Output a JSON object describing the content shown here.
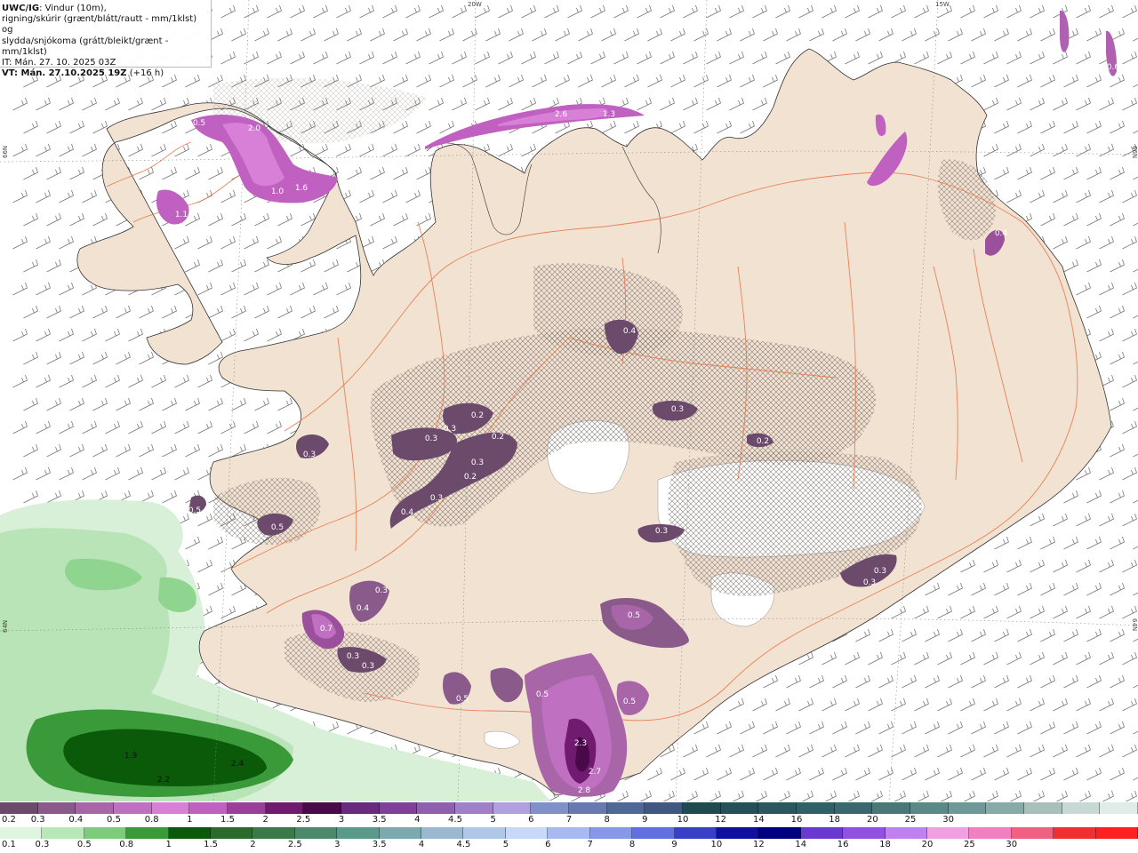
{
  "header": {
    "product": "UWC/IG",
    "line1_rest": ": Vindur (10m),",
    "line2": "rigning/skúrir (grænt/blátt/rautt - mm/1klst) og",
    "line3": "slydda/snjókoma (grátt/bleikt/grænt - mm/1klst)",
    "line4": "IT: Mán. 27. 10. 2025 03Z",
    "vt_label": "VT: Mán. 27.10.2025 19Z",
    "vt_rest": " (+16 h)"
  },
  "grid_labels": {
    "top_20w": "20W",
    "top_15w": "15W",
    "left_66n": "66N",
    "left_64n": "64N",
    "right_66n": "66N",
    "right_64n": "64N"
  },
  "colors": {
    "land": "#f2e2d2",
    "roads": "#e8774a",
    "coast": "#333333",
    "wind_barbs": "#777777",
    "hatch": "#7a6f6a"
  },
  "precip_labels": [
    {
      "text": "0.5"
    },
    {
      "text": "2.0"
    },
    {
      "text": "1.0"
    },
    {
      "text": "1.6"
    },
    {
      "text": "1.1"
    },
    {
      "text": "0.6"
    },
    {
      "text": "2.6"
    },
    {
      "text": "1.3"
    },
    {
      "text": "0.3"
    },
    {
      "text": "0.2"
    },
    {
      "text": "0.4"
    },
    {
      "text": "0.3"
    },
    {
      "text": "0.2"
    },
    {
      "text": "0.3"
    },
    {
      "text": "0.5"
    },
    {
      "text": "2.3"
    },
    {
      "text": "2.7"
    },
    {
      "text": "2.8"
    },
    {
      "text": "1.9"
    },
    {
      "text": "2.2"
    },
    {
      "text": "2.4"
    },
    {
      "text": "0.7"
    }
  ],
  "legend_snow": {
    "colors": [
      "#6b4a6b",
      "#8a5a8a",
      "#a866a8",
      "#c070c0",
      "#d880d8",
      "#c060c0",
      "#9a409a",
      "#701a70",
      "#4a0a4a",
      "#6a2a80",
      "#80409a",
      "#9060b0",
      "#a080c8",
      "#b0a0e0",
      "#8090c8",
      "#6878b0",
      "#506898",
      "#405880",
      "#1e4a50",
      "#24505a",
      "#2a5860",
      "#306068",
      "#3a6870",
      "#487878",
      "#5a8a88",
      "#709898",
      "#88aaa8",
      "#a8c0bc",
      "#c8d8d4",
      "#e0ece8"
    ],
    "labels": [
      "0.2",
      "0.3",
      "0.4",
      "0.5",
      "0.8",
      "1",
      "1.5",
      "2",
      "2.5",
      "3",
      "3.5",
      "4",
      "4.5",
      "5",
      "6",
      "7",
      "8",
      "9",
      "10",
      "12",
      "14",
      "16",
      "18",
      "20",
      "25",
      "30"
    ]
  },
  "legend_rain": {
    "colors": [
      "#e0f5e0",
      "#b8e8b8",
      "#7ccc7c",
      "#3a9a3a",
      "#0a5a0a",
      "#2a6a2a",
      "#3a7a4a",
      "#4a8a6a",
      "#5a9a8a",
      "#7aaab0",
      "#9ab8d0",
      "#b0c8e8",
      "#c8d8f8",
      "#a8b8f0",
      "#8898e8",
      "#6070e0",
      "#3840c8",
      "#1010a0",
      "#000080",
      "#6a3ad0",
      "#9050e0",
      "#c080f0",
      "#f0a0e0",
      "#f080c0",
      "#f06080",
      "#f03030",
      "#ff2020"
    ],
    "labels": [
      "0.1",
      "0.3",
      "0.5",
      "0.8",
      "1",
      "1.5",
      "2",
      "2.5",
      "3",
      "3.5",
      "4",
      "4.5",
      "5",
      "6",
      "7",
      "8",
      "9",
      "10",
      "12",
      "14",
      "16",
      "18",
      "20",
      "25",
      "30"
    ]
  }
}
